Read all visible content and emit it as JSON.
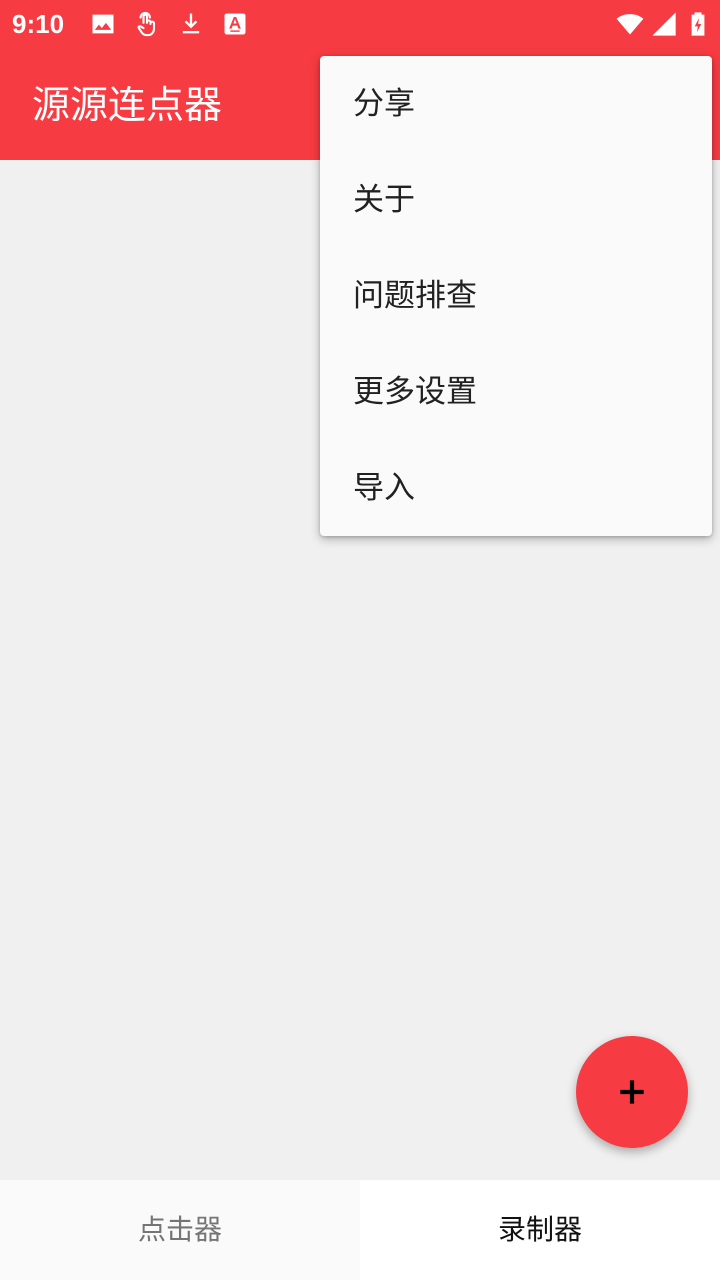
{
  "status_bar": {
    "time": "9:10",
    "left_icons": [
      "image-icon",
      "touch-icon",
      "download-icon",
      "keyboard-a-icon"
    ],
    "right_icons": [
      "wifi-icon",
      "cell-signal-icon",
      "battery-charging-icon"
    ]
  },
  "app_bar": {
    "title": "源源连点器"
  },
  "overflow_menu": {
    "items": [
      {
        "label": "分享"
      },
      {
        "label": "关于"
      },
      {
        "label": "问题排查"
      },
      {
        "label": "更多设置"
      },
      {
        "label": "导入"
      }
    ]
  },
  "fab": {
    "icon": "plus-icon"
  },
  "bottom_nav": {
    "tabs": [
      {
        "label": "点击器",
        "selected": false
      },
      {
        "label": "录制器",
        "selected": true
      }
    ]
  },
  "colors": {
    "accent": "#f73b42",
    "background": "#f0f0f0",
    "menu_background": "#fafafa"
  }
}
